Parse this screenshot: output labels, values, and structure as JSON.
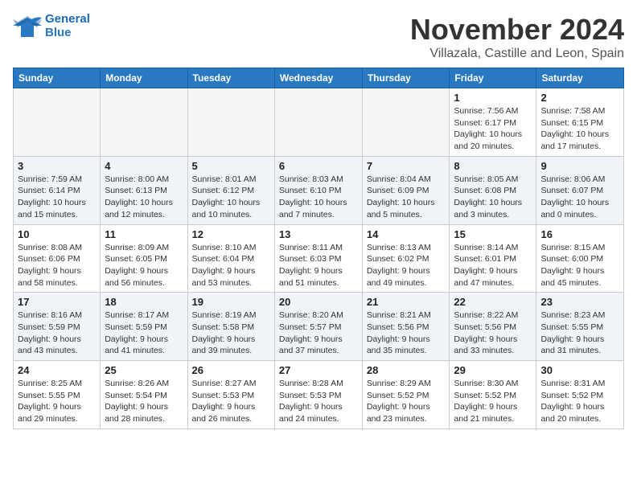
{
  "header": {
    "logo_line1": "General",
    "logo_line2": "Blue",
    "month": "November 2024",
    "location": "Villazala, Castille and Leon, Spain"
  },
  "days_of_week": [
    "Sunday",
    "Monday",
    "Tuesday",
    "Wednesday",
    "Thursday",
    "Friday",
    "Saturday"
  ],
  "weeks": [
    [
      {
        "day": "",
        "info": ""
      },
      {
        "day": "",
        "info": ""
      },
      {
        "day": "",
        "info": ""
      },
      {
        "day": "",
        "info": ""
      },
      {
        "day": "",
        "info": ""
      },
      {
        "day": "1",
        "info": "Sunrise: 7:56 AM\nSunset: 6:17 PM\nDaylight: 10 hours\nand 20 minutes."
      },
      {
        "day": "2",
        "info": "Sunrise: 7:58 AM\nSunset: 6:15 PM\nDaylight: 10 hours\nand 17 minutes."
      }
    ],
    [
      {
        "day": "3",
        "info": "Sunrise: 7:59 AM\nSunset: 6:14 PM\nDaylight: 10 hours\nand 15 minutes."
      },
      {
        "day": "4",
        "info": "Sunrise: 8:00 AM\nSunset: 6:13 PM\nDaylight: 10 hours\nand 12 minutes."
      },
      {
        "day": "5",
        "info": "Sunrise: 8:01 AM\nSunset: 6:12 PM\nDaylight: 10 hours\nand 10 minutes."
      },
      {
        "day": "6",
        "info": "Sunrise: 8:03 AM\nSunset: 6:10 PM\nDaylight: 10 hours\nand 7 minutes."
      },
      {
        "day": "7",
        "info": "Sunrise: 8:04 AM\nSunset: 6:09 PM\nDaylight: 10 hours\nand 5 minutes."
      },
      {
        "day": "8",
        "info": "Sunrise: 8:05 AM\nSunset: 6:08 PM\nDaylight: 10 hours\nand 3 minutes."
      },
      {
        "day": "9",
        "info": "Sunrise: 8:06 AM\nSunset: 6:07 PM\nDaylight: 10 hours\nand 0 minutes."
      }
    ],
    [
      {
        "day": "10",
        "info": "Sunrise: 8:08 AM\nSunset: 6:06 PM\nDaylight: 9 hours\nand 58 minutes."
      },
      {
        "day": "11",
        "info": "Sunrise: 8:09 AM\nSunset: 6:05 PM\nDaylight: 9 hours\nand 56 minutes."
      },
      {
        "day": "12",
        "info": "Sunrise: 8:10 AM\nSunset: 6:04 PM\nDaylight: 9 hours\nand 53 minutes."
      },
      {
        "day": "13",
        "info": "Sunrise: 8:11 AM\nSunset: 6:03 PM\nDaylight: 9 hours\nand 51 minutes."
      },
      {
        "day": "14",
        "info": "Sunrise: 8:13 AM\nSunset: 6:02 PM\nDaylight: 9 hours\nand 49 minutes."
      },
      {
        "day": "15",
        "info": "Sunrise: 8:14 AM\nSunset: 6:01 PM\nDaylight: 9 hours\nand 47 minutes."
      },
      {
        "day": "16",
        "info": "Sunrise: 8:15 AM\nSunset: 6:00 PM\nDaylight: 9 hours\nand 45 minutes."
      }
    ],
    [
      {
        "day": "17",
        "info": "Sunrise: 8:16 AM\nSunset: 5:59 PM\nDaylight: 9 hours\nand 43 minutes."
      },
      {
        "day": "18",
        "info": "Sunrise: 8:17 AM\nSunset: 5:59 PM\nDaylight: 9 hours\nand 41 minutes."
      },
      {
        "day": "19",
        "info": "Sunrise: 8:19 AM\nSunset: 5:58 PM\nDaylight: 9 hours\nand 39 minutes."
      },
      {
        "day": "20",
        "info": "Sunrise: 8:20 AM\nSunset: 5:57 PM\nDaylight: 9 hours\nand 37 minutes."
      },
      {
        "day": "21",
        "info": "Sunrise: 8:21 AM\nSunset: 5:56 PM\nDaylight: 9 hours\nand 35 minutes."
      },
      {
        "day": "22",
        "info": "Sunrise: 8:22 AM\nSunset: 5:56 PM\nDaylight: 9 hours\nand 33 minutes."
      },
      {
        "day": "23",
        "info": "Sunrise: 8:23 AM\nSunset: 5:55 PM\nDaylight: 9 hours\nand 31 minutes."
      }
    ],
    [
      {
        "day": "24",
        "info": "Sunrise: 8:25 AM\nSunset: 5:55 PM\nDaylight: 9 hours\nand 29 minutes."
      },
      {
        "day": "25",
        "info": "Sunrise: 8:26 AM\nSunset: 5:54 PM\nDaylight: 9 hours\nand 28 minutes."
      },
      {
        "day": "26",
        "info": "Sunrise: 8:27 AM\nSunset: 5:53 PM\nDaylight: 9 hours\nand 26 minutes."
      },
      {
        "day": "27",
        "info": "Sunrise: 8:28 AM\nSunset: 5:53 PM\nDaylight: 9 hours\nand 24 minutes."
      },
      {
        "day": "28",
        "info": "Sunrise: 8:29 AM\nSunset: 5:52 PM\nDaylight: 9 hours\nand 23 minutes."
      },
      {
        "day": "29",
        "info": "Sunrise: 8:30 AM\nSunset: 5:52 PM\nDaylight: 9 hours\nand 21 minutes."
      },
      {
        "day": "30",
        "info": "Sunrise: 8:31 AM\nSunset: 5:52 PM\nDaylight: 9 hours\nand 20 minutes."
      }
    ]
  ]
}
